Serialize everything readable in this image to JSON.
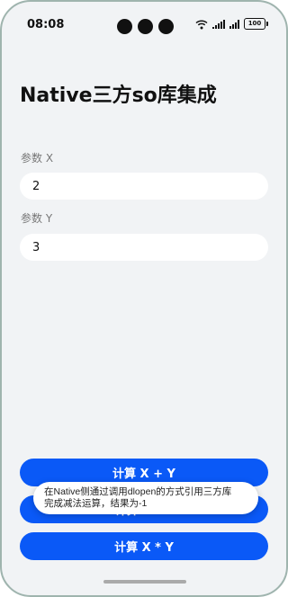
{
  "status_bar": {
    "time": "08:08",
    "battery": "100",
    "icons": [
      "wifi-icon",
      "signal-icon",
      "signal-icon",
      "battery-icon"
    ]
  },
  "page": {
    "title": "Native三方so库集成"
  },
  "form": {
    "x_label": "参数 X",
    "x_value": "2",
    "y_label": "参数 Y",
    "y_value": "3"
  },
  "buttons": {
    "add_label": "计算 X + Y",
    "sub_label": "计算 X - Y",
    "mul_label": "计算 X * Y"
  },
  "toast": {
    "line1": "在Native侧通过调用dlopen的方式引用三方库",
    "line2": "完成减法运算，结果为-1"
  },
  "colors": {
    "accent": "#0a59f7",
    "background": "#f1f3f5"
  }
}
